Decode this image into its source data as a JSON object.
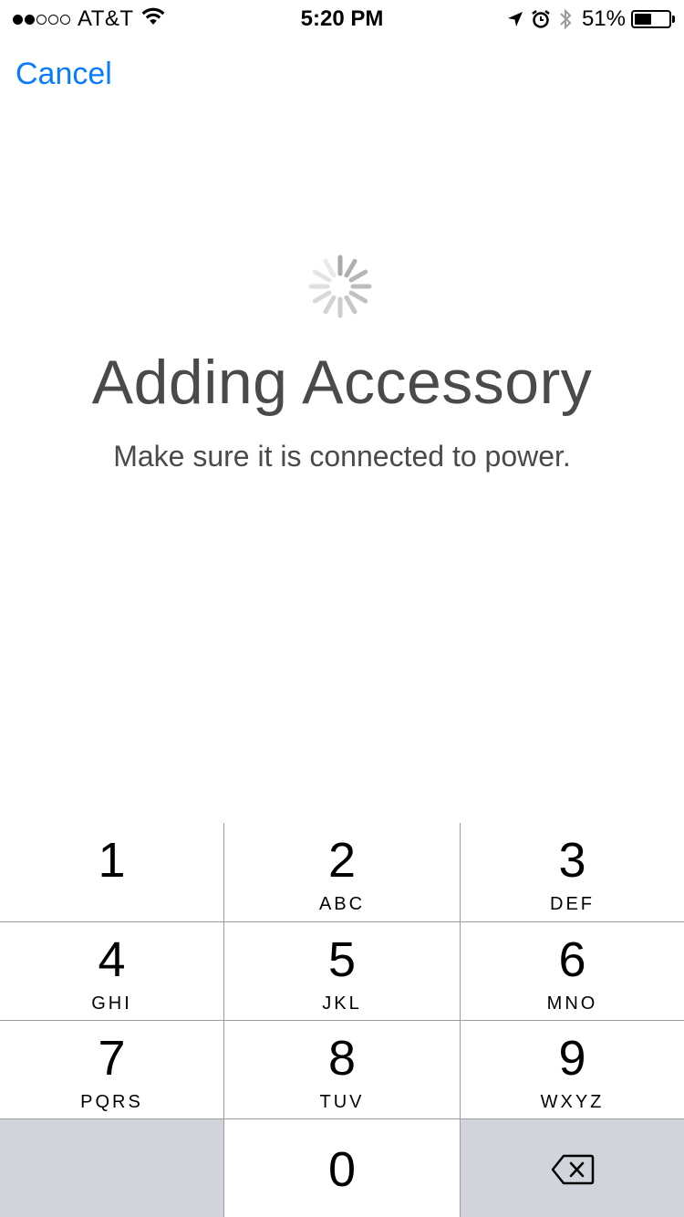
{
  "status_bar": {
    "carrier": "AT&T",
    "time": "5:20 PM",
    "battery_percent": "51%",
    "battery_level": 0.51,
    "signal_strength": 2,
    "signal_max": 5,
    "icons": [
      "wifi-icon",
      "location-arrow-icon",
      "alarm-icon",
      "bluetooth-icon",
      "battery-icon"
    ]
  },
  "nav": {
    "cancel_label": "Cancel"
  },
  "main": {
    "title": "Adding Accessory",
    "subtitle": "Make sure it is connected to power.",
    "spinner_icon": "loading-spinner-icon"
  },
  "keypad": {
    "keys": [
      {
        "digit": "1",
        "letters": ""
      },
      {
        "digit": "2",
        "letters": "ABC"
      },
      {
        "digit": "3",
        "letters": "DEF"
      },
      {
        "digit": "4",
        "letters": "GHI"
      },
      {
        "digit": "5",
        "letters": "JKL"
      },
      {
        "digit": "6",
        "letters": "MNO"
      },
      {
        "digit": "7",
        "letters": "PQRS"
      },
      {
        "digit": "8",
        "letters": "TUV"
      },
      {
        "digit": "9",
        "letters": "WXYZ"
      },
      {
        "digit": "0",
        "letters": ""
      }
    ],
    "delete_icon": "delete-backspace-icon",
    "colors": {
      "key_background": "#ffffff",
      "function_key_background": "#d1d4da",
      "separator": "#9d9d9d"
    }
  },
  "colors": {
    "accent": "#0a7aff",
    "text_primary": "#4a4a4a"
  }
}
